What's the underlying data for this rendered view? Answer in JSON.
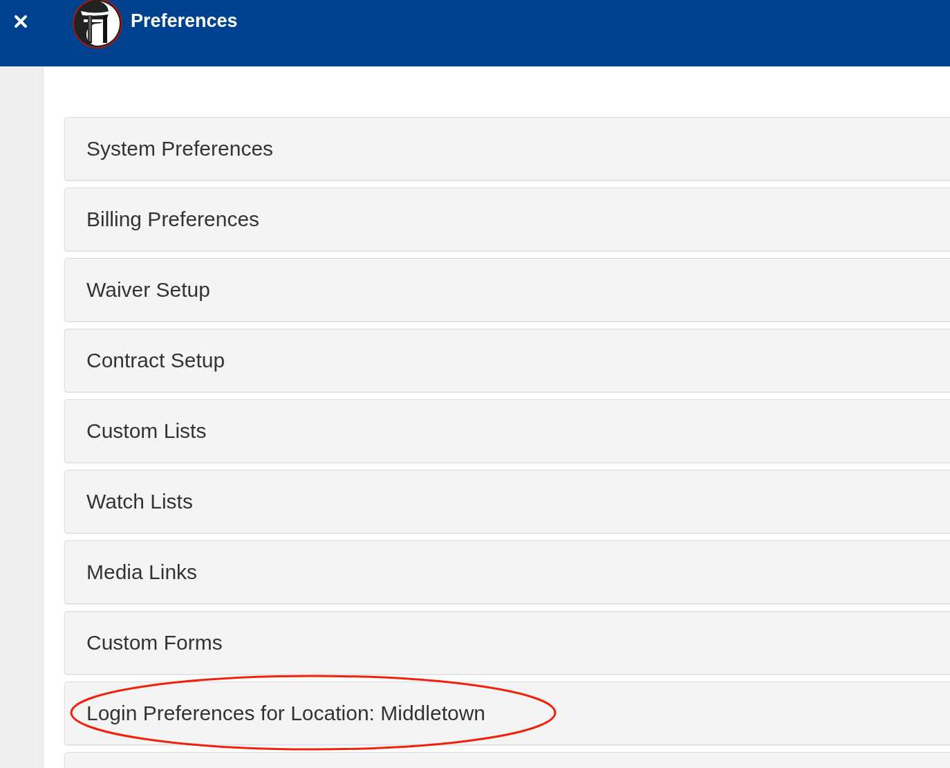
{
  "header": {
    "title": "Preferences"
  },
  "panels": [
    {
      "label": "System Preferences",
      "circled": false
    },
    {
      "label": "Billing Preferences",
      "circled": false
    },
    {
      "label": "Waiver Setup",
      "circled": false
    },
    {
      "label": "Contract Setup",
      "circled": false
    },
    {
      "label": "Custom Lists",
      "circled": false
    },
    {
      "label": "Watch Lists",
      "circled": false
    },
    {
      "label": "Media Links",
      "circled": false
    },
    {
      "label": "Custom Forms",
      "circled": false
    },
    {
      "label": "Login Preferences for Location: Middletown",
      "circled": true
    }
  ]
}
